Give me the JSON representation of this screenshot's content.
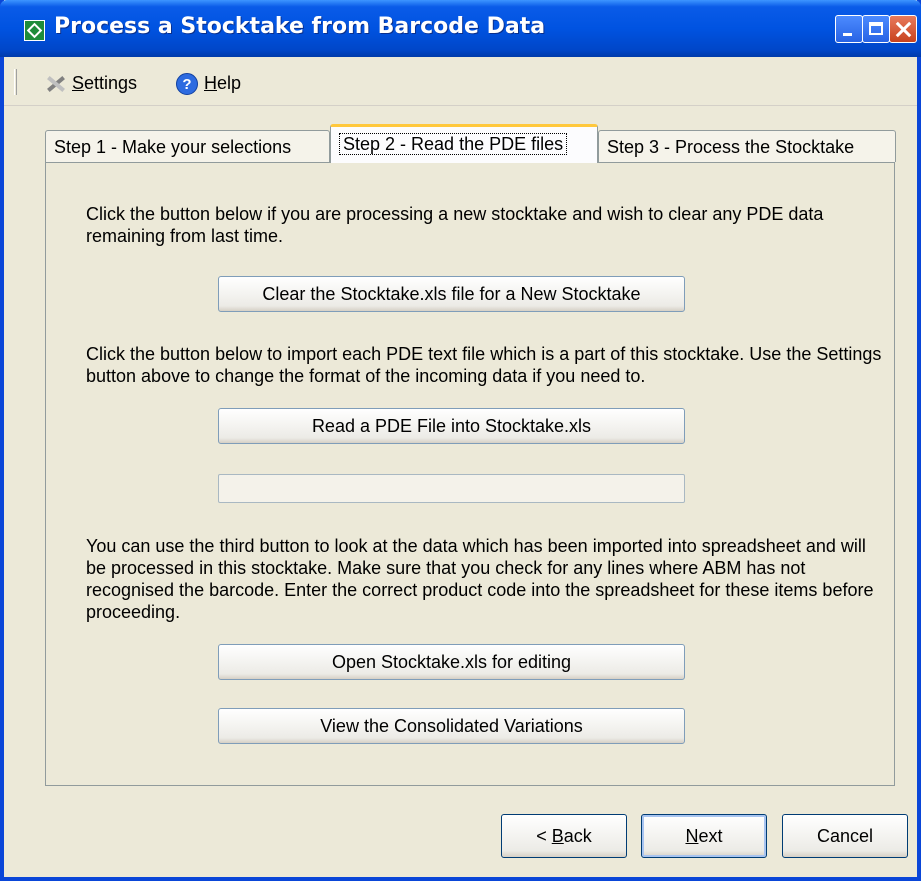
{
  "window": {
    "title": "Process a Stocktake from Barcode Data"
  },
  "toolbar": {
    "settings_label": "Settings",
    "help_label": "Help"
  },
  "tabs": [
    {
      "label": "Step 1 - Make your selections"
    },
    {
      "label": "Step 2 - Read the PDE files"
    },
    {
      "label": "Step 3 - Process the Stocktake"
    }
  ],
  "active_tab": 1,
  "step2": {
    "para1": "Click the button below if you are processing a new stocktake and wish to clear any PDE data remaining from last time.",
    "clear_button": "Clear the Stocktake.xls file for a New Stocktake",
    "para2": "Click the button below to import each PDE text file which is a part of this stocktake. Use the Settings button above to change the format of the incoming data if you need to.",
    "read_button": "Read a PDE File into Stocktake.xls",
    "progress_fraction": 0,
    "para3": "You can use the third button to look at the data which has been imported into spreadsheet and will be processed in this stocktake. Make sure that you check for any lines where ABM has not recognised the barcode. Enter the correct product code into the spreadsheet for these items before proceeding.",
    "open_button": "Open Stocktake.xls for editing",
    "view_button": "View the Consolidated Variations"
  },
  "footer": {
    "back_label": "Back",
    "next_label": "Next",
    "cancel_label": "Cancel"
  },
  "colors": {
    "titlebar": "#0053E1",
    "background": "#ECE9D8",
    "active_tab_highlight": "#FFC83C"
  }
}
